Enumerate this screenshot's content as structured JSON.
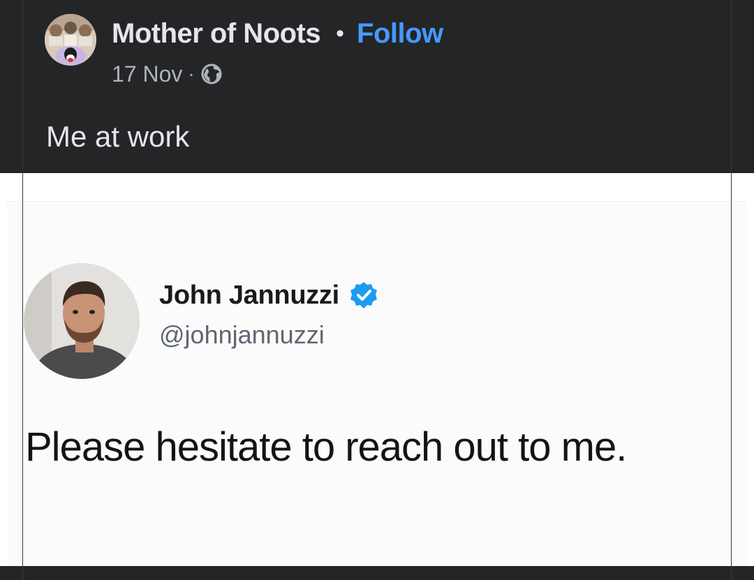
{
  "post": {
    "author": "Mother of Noots",
    "separator": "•",
    "follow_label": "Follow",
    "date": "17 Nov",
    "meta_separator": "·",
    "audience_icon": "globe-icon",
    "caption": "Me at work"
  },
  "tweet": {
    "name": "John Jannuzzi",
    "verified_icon": "verified-badge-icon",
    "handle": "@johnjannuzzi",
    "text": "Please hesitate to reach out to me."
  },
  "colors": {
    "background": "#242526",
    "text_primary": "#e4e6eb",
    "text_secondary": "#b0b3b8",
    "link": "#4599ff",
    "verified": "#1d9bf0"
  }
}
